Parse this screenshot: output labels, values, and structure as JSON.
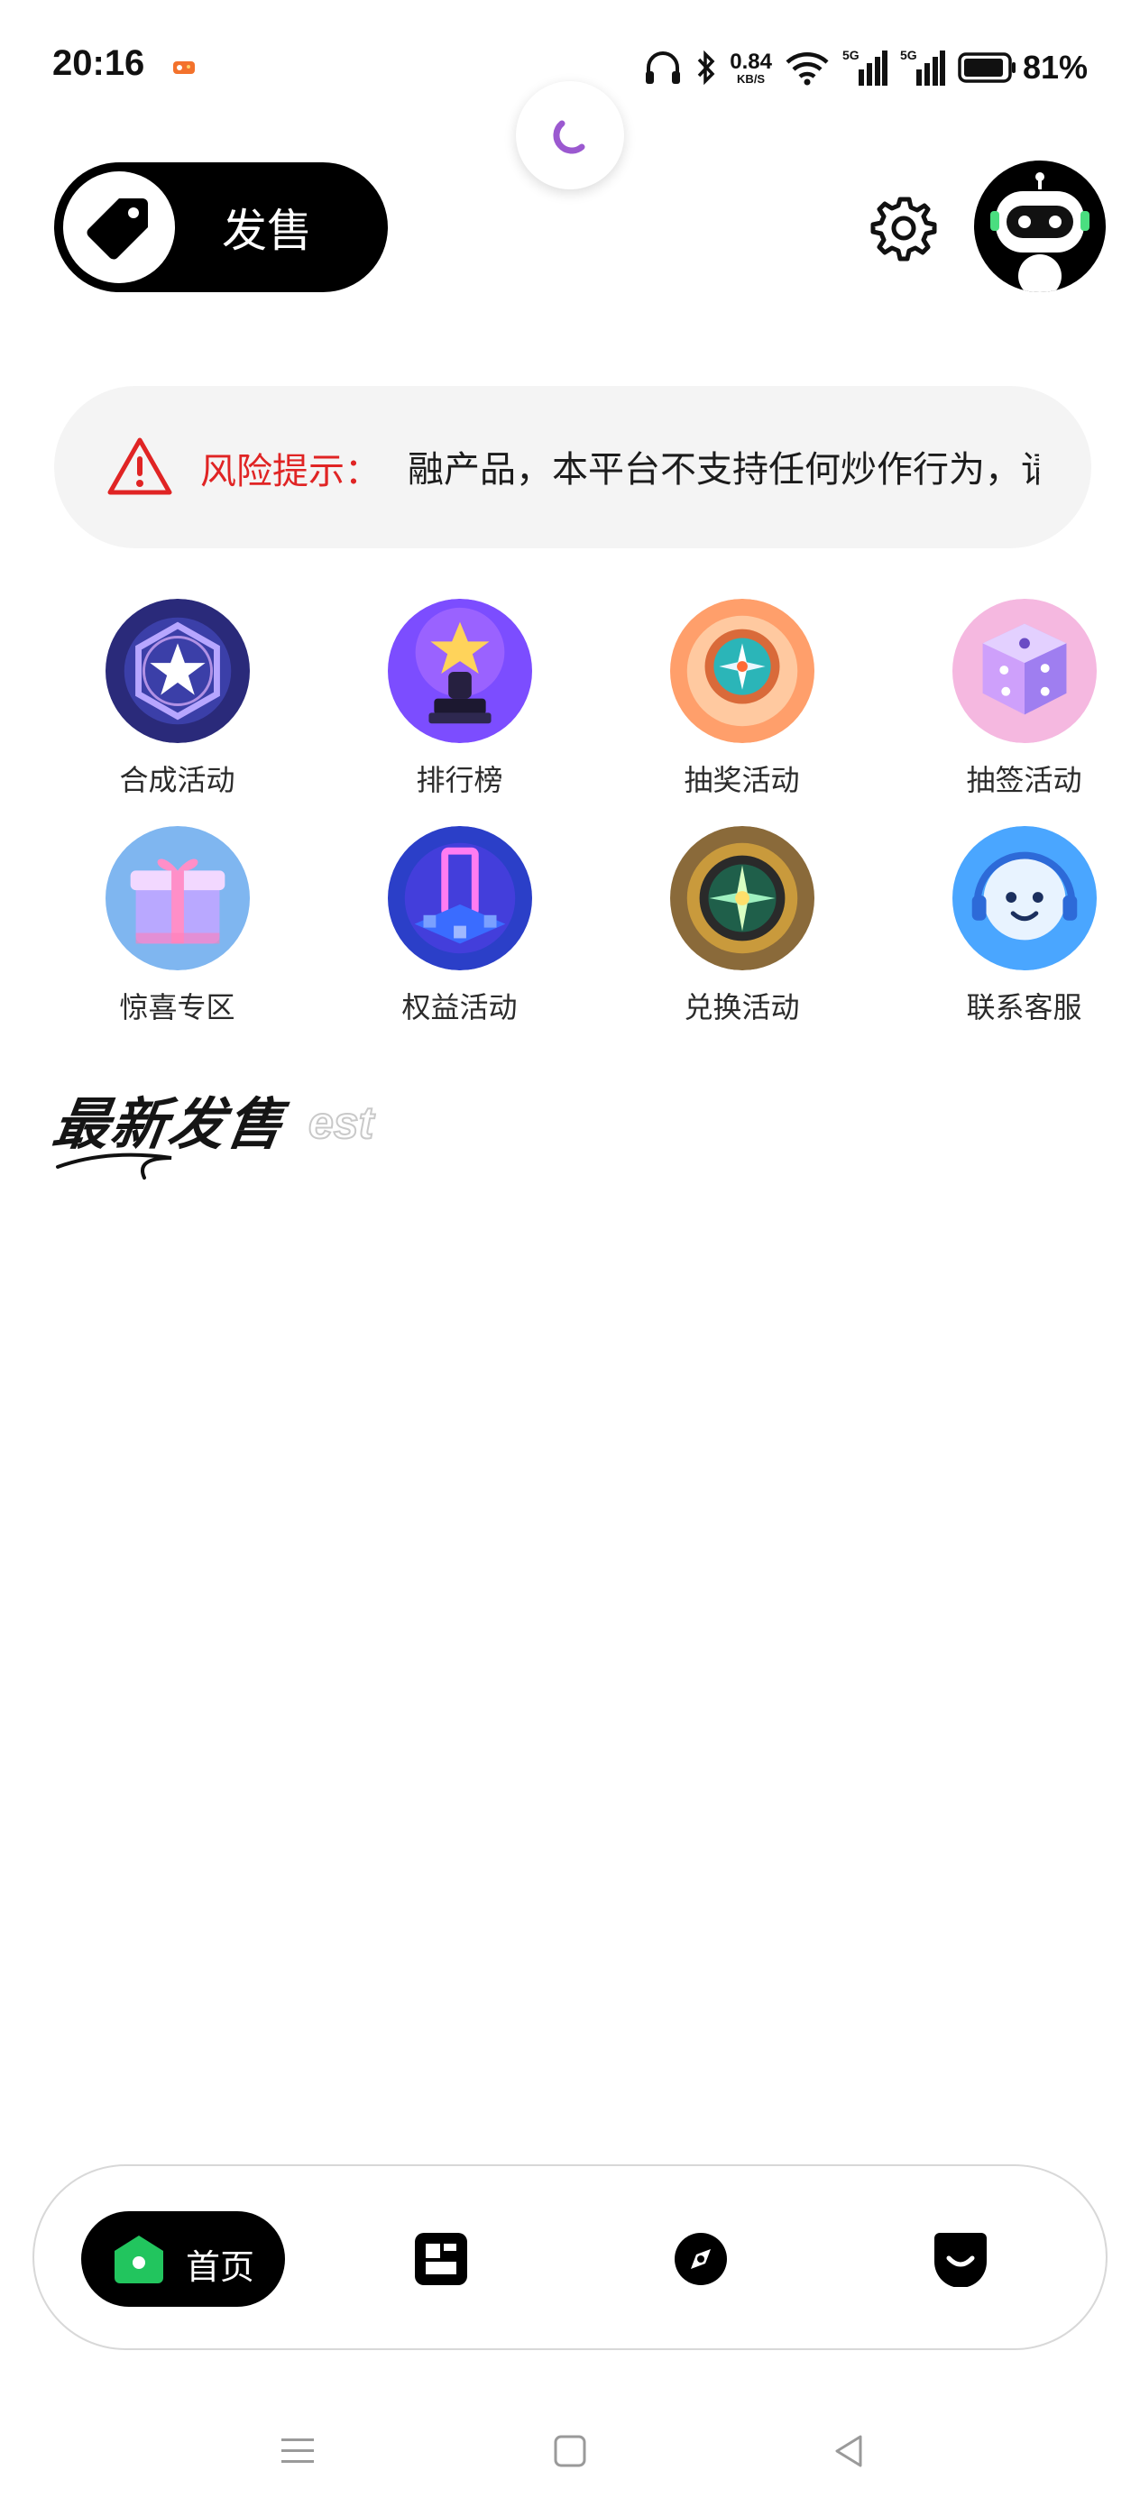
{
  "status_bar": {
    "time": "20:16",
    "net_speed_value": "0.84",
    "net_speed_unit": "KB/S",
    "signal1_label": "5G",
    "signal2_label": "5G",
    "battery_text": "81%"
  },
  "header": {
    "sale_label": "发售"
  },
  "risk_notice": {
    "label": "风险提示：",
    "text": "融产品，本平台不支持任何炒作行为，请"
  },
  "grid": [
    {
      "label": "合成活动",
      "icon": "synthesis-star-icon"
    },
    {
      "label": "排行榜",
      "icon": "trophy-icon"
    },
    {
      "label": "抽奖活动",
      "icon": "lottery-compass-icon"
    },
    {
      "label": "抽签活动",
      "icon": "dice-icon"
    },
    {
      "label": "惊喜专区",
      "icon": "gift-box-icon"
    },
    {
      "label": "权益活动",
      "icon": "portal-icon"
    },
    {
      "label": "兑换活动",
      "icon": "exchange-compass-icon"
    },
    {
      "label": "联系客服",
      "icon": "customer-service-icon"
    }
  ],
  "latest": {
    "title": "最新发售",
    "sub": "est"
  },
  "bottom_nav": {
    "home_label": "首页",
    "items": [
      "home-icon",
      "market-icon",
      "discover-icon",
      "profile-icon"
    ]
  },
  "colors": {
    "accent_green": "#22c55e",
    "risk_red": "#e02424",
    "spinner_purple": "#9b59d0"
  }
}
